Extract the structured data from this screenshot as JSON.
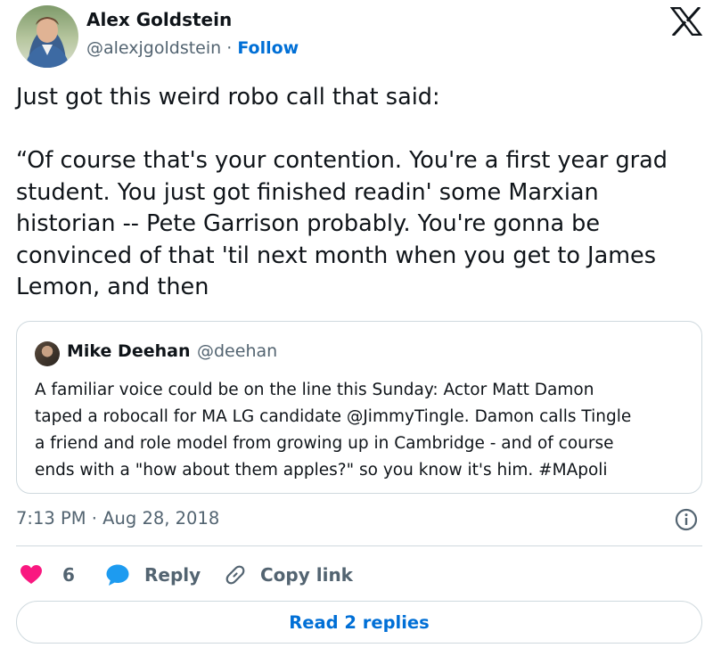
{
  "author": {
    "name": "Alex Goldstein",
    "handle": "@alexjgoldstein",
    "separator": "·",
    "follow_label": "Follow"
  },
  "tweet": {
    "lines": [
      "Just got this weird robo call that said:",
      "",
      "“Of course that's your contention. You're a first year grad",
      "student. You just got finished readin' some Marxian",
      "historian -- Pete Garrison probably. You're gonna be",
      "convinced of that 'til next month when you get to James",
      "Lemon, and then"
    ]
  },
  "quoted_tweet": {
    "name": "Mike Deehan",
    "handle": "@deehan",
    "lines": [
      "A familiar voice could be on the line this Sunday: Actor Matt Damon",
      "taped a robocall for MA LG candidate @JimmyTingle. Damon calls Tingle",
      "a friend and role model from growing up in Cambridge - and of course",
      "ends with a \"how about them apples?\" so you know it's him. #MApoli"
    ]
  },
  "timestamp": "7:13 PM · Aug 28, 2018",
  "actions": {
    "like_count": "6",
    "reply_label": "Reply",
    "copy_link_label": "Copy link"
  },
  "read_replies_label": "Read 2 replies",
  "colors": {
    "like": "#f91880",
    "reply": "#1d9bf0",
    "link": "#006fd6",
    "secondary_text": "#536471",
    "border": "#cfd9de"
  },
  "icons": [
    "x-logo-icon",
    "info-icon",
    "heart-icon",
    "speech-bubble-icon",
    "link-icon"
  ]
}
